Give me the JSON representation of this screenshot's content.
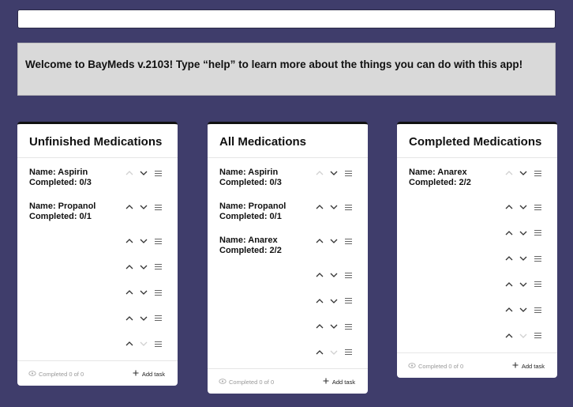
{
  "command_input": {
    "placeholder": ""
  },
  "welcome": "Welcome to BayMeds v.2103! Type “help” to learn more about the things you can do with this app!",
  "columns": [
    {
      "title": "Unfinished Medications",
      "items": [
        {
          "name": "Name: Aspirin",
          "completed": "Completed: 0/3"
        },
        {
          "name": "Name: Propanol",
          "completed": "Completed: 0/1"
        }
      ],
      "empty_rows": 5,
      "footer_completed": "Completed 0 of 0",
      "footer_add": "Add task"
    },
    {
      "title": "All Medications",
      "items": [
        {
          "name": "Name: Aspirin",
          "completed": "Completed: 0/3"
        },
        {
          "name": "Name: Propanol",
          "completed": "Completed: 0/1"
        },
        {
          "name": "Name: Anarex",
          "completed": "Completed: 2/2"
        }
      ],
      "empty_rows": 4,
      "footer_completed": "Completed 0 of 0",
      "footer_add": "Add task"
    },
    {
      "title": "Completed Medications",
      "items": [
        {
          "name": "Name: Anarex",
          "completed": "Completed: 2/2"
        }
      ],
      "empty_rows": 6,
      "footer_completed": "Completed 0 of 0",
      "footer_add": "Add task"
    }
  ],
  "icons": {
    "up": "chevron-up-icon",
    "down": "chevron-down-icon",
    "menu": "menu-icon",
    "eye": "eye-icon",
    "plus": "plus-icon"
  }
}
